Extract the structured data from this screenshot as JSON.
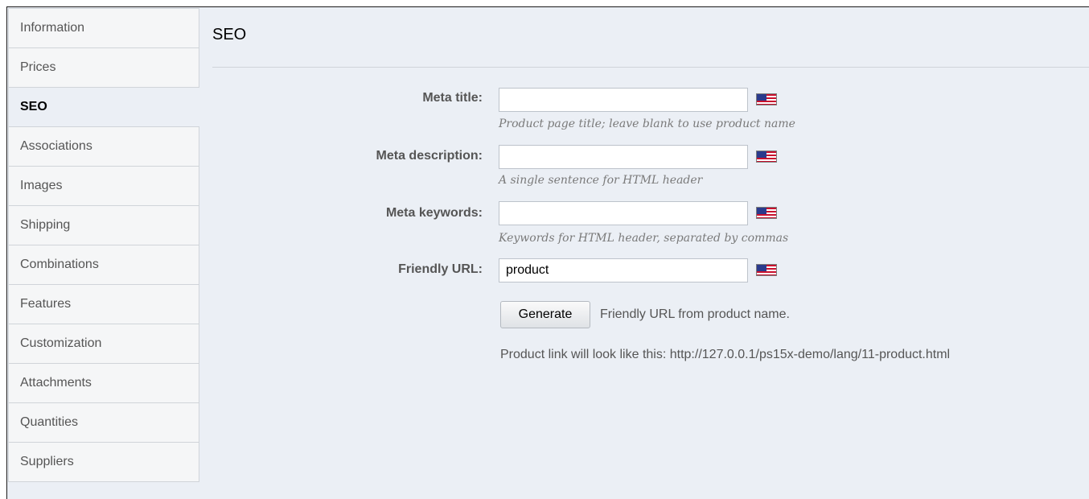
{
  "sidebar": {
    "items": [
      {
        "label": "Information"
      },
      {
        "label": "Prices"
      },
      {
        "label": "SEO"
      },
      {
        "label": "Associations"
      },
      {
        "label": "Images"
      },
      {
        "label": "Shipping"
      },
      {
        "label": "Combinations"
      },
      {
        "label": "Features"
      },
      {
        "label": "Customization"
      },
      {
        "label": "Attachments"
      },
      {
        "label": "Quantities"
      },
      {
        "label": "Suppliers"
      }
    ],
    "active_index": 2
  },
  "main": {
    "title": "SEO",
    "fields": {
      "meta_title": {
        "label": "Meta title:",
        "value": "",
        "hint": "Product page title; leave blank to use product name"
      },
      "meta_description": {
        "label": "Meta description:",
        "value": "",
        "hint": "A single sentence for HTML header"
      },
      "meta_keywords": {
        "label": "Meta keywords:",
        "value": "",
        "hint": "Keywords for HTML header, separated by commas"
      },
      "friendly_url": {
        "label": "Friendly URL:",
        "value": "product"
      }
    },
    "generate_button": "Generate",
    "generate_note": "Friendly URL from product name.",
    "product_link": "Product link will look like this: http://127.0.0.1/ps15x-demo/lang/11-product.html",
    "language_flag_icon": "us-flag-icon"
  },
  "colors": {
    "panel_background": "#ebeff5",
    "tab_background": "#f5f6f7",
    "label_text": "#555555",
    "hint_text": "#7a7a7a"
  }
}
